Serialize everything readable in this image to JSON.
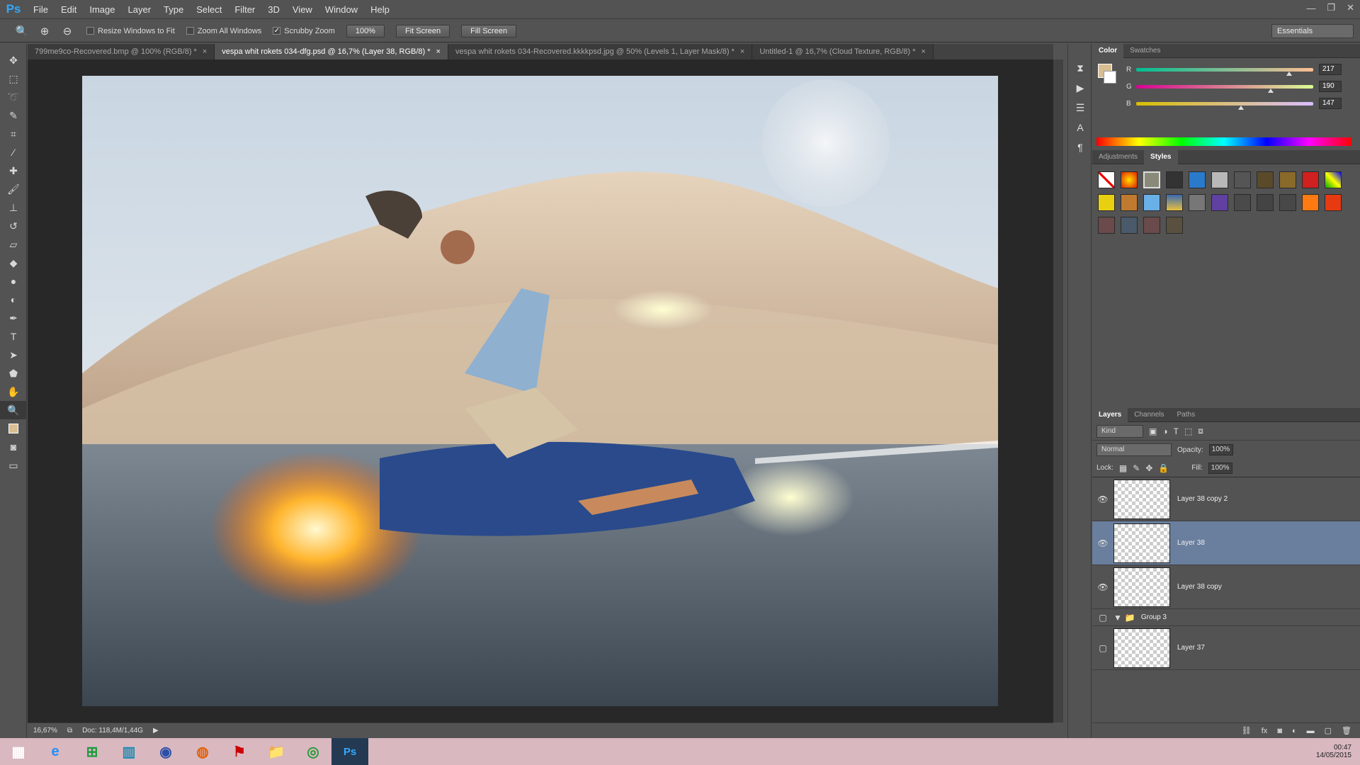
{
  "app": {
    "logo": "Ps"
  },
  "menu": [
    "File",
    "Edit",
    "Image",
    "Layer",
    "Type",
    "Select",
    "Filter",
    "3D",
    "View",
    "Window",
    "Help"
  ],
  "window_controls": {
    "minimize": "—",
    "restore": "❐",
    "close": "✕"
  },
  "options": {
    "resize_windows": "Resize Windows to Fit",
    "zoom_all": "Zoom All Windows",
    "scrubby": "Scrubby Zoom",
    "btn_100": "100%",
    "fit_screen": "Fit Screen",
    "fill_screen": "Fill Screen",
    "workspace": "Essentials"
  },
  "tabs": [
    {
      "label": "799me9co-Recovered.bmp @ 100% (RGB/8) *",
      "active": false
    },
    {
      "label": "vespa whit rokets 034-dfg.psd @ 16,7% (Layer 38, RGB/8) *",
      "active": true
    },
    {
      "label": "vespa whit rokets 034-Recovered.kkkkpsd.jpg @ 50% (Levels 1, Layer Mask/8) *",
      "active": false
    },
    {
      "label": "Untitled-1 @ 16,7% (Cloud Texture, RGB/8) *",
      "active": false
    }
  ],
  "status": {
    "zoom": "16,67%",
    "doc": "Doc: 118,4M/1,44G"
  },
  "color_panel": {
    "tabs": [
      "Color",
      "Swatches"
    ],
    "r": {
      "label": "R",
      "value": "217"
    },
    "g": {
      "label": "G",
      "value": "190"
    },
    "b": {
      "label": "B",
      "value": "147"
    },
    "fg_color": "#d9be93"
  },
  "styles_panel": {
    "tabs": [
      "Adjustments",
      "Styles"
    ]
  },
  "layers_panel": {
    "tabs": [
      "Layers",
      "Channels",
      "Paths"
    ],
    "kind": "Kind",
    "blend": "Normal",
    "opacity_label": "Opacity:",
    "opacity": "100%",
    "lock_label": "Lock:",
    "fill_label": "Fill:",
    "fill": "100%",
    "layers": [
      {
        "name": "Layer 38 copy 2",
        "visible": true,
        "selected": false
      },
      {
        "name": "Layer 38",
        "visible": true,
        "selected": true
      },
      {
        "name": "Layer 38 copy",
        "visible": true,
        "selected": false
      }
    ],
    "group": "Group 3",
    "layer37": "Layer 37"
  },
  "clock": {
    "time": "00:47",
    "date": "14/05/2015"
  }
}
